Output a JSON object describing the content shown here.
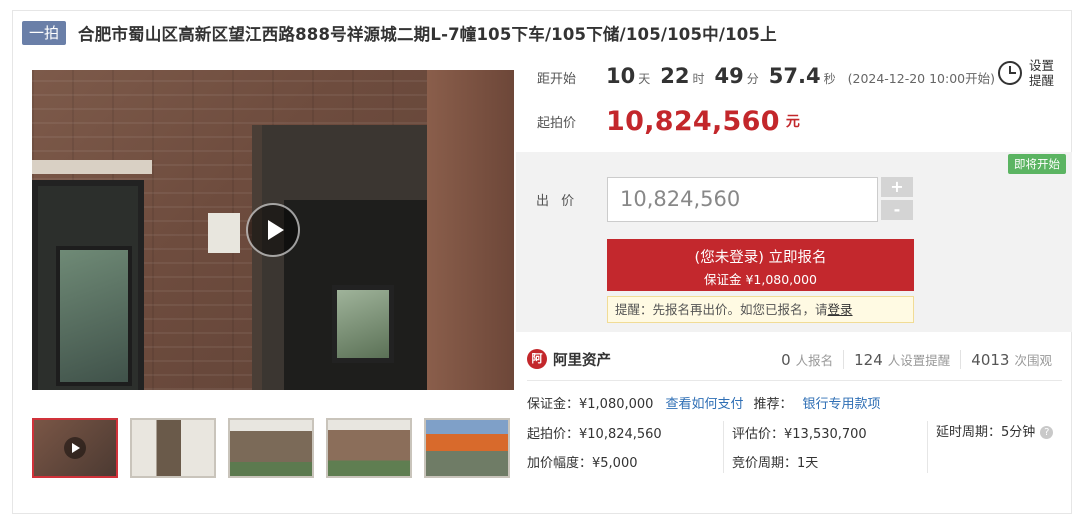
{
  "title": {
    "tag": "一拍",
    "text": "合肥市蜀山区高新区望江西路888号祥源城二期L-7幢105下车/105下储/105/105中/105上"
  },
  "gallery": {
    "thumb_count": 5
  },
  "countdown": {
    "label": "距开始",
    "days": "10",
    "days_unit": "天",
    "hours": "22",
    "hours_unit": "时",
    "minutes": "49",
    "minutes_unit": "分",
    "seconds": "57.4",
    "seconds_unit": "秒",
    "start_note": "(2024-12-20 10:00开始)"
  },
  "reminder": {
    "label": "设置提醒"
  },
  "starting_price": {
    "label": "起拍价",
    "value": "10,824,560",
    "unit": "元"
  },
  "bid": {
    "status_tag": "即将开始",
    "label": "出 价",
    "input_value": "10,824,560",
    "plus": "+",
    "minus": "-",
    "apply_line1": "(您未登录) 立即报名",
    "apply_line2": "保证金 ¥1,080,000",
    "tip_text": "提醒：先报名再出价。如您已报名，请",
    "tip_link": "登录"
  },
  "platform": {
    "logo_glyph": "阿",
    "name": "阿里资产",
    "stats": [
      {
        "num": "0",
        "label": "人报名"
      },
      {
        "num": "124",
        "label": "人设置提醒"
      },
      {
        "num": "4013",
        "label": "次围观"
      }
    ]
  },
  "info": {
    "deposit": "保证金：¥1,080,000",
    "how_to_pay": "查看如何支付",
    "recommend_label": "推荐：",
    "recommend_link": "银行专用款项",
    "start_price": "起拍价：¥10,824,560",
    "appraisal": "评估价：¥13,530,700",
    "delay_period": "延时周期：5分钟",
    "increment": "加价幅度：¥5,000",
    "bid_period": "竞价周期：1天",
    "help_glyph": "?"
  }
}
